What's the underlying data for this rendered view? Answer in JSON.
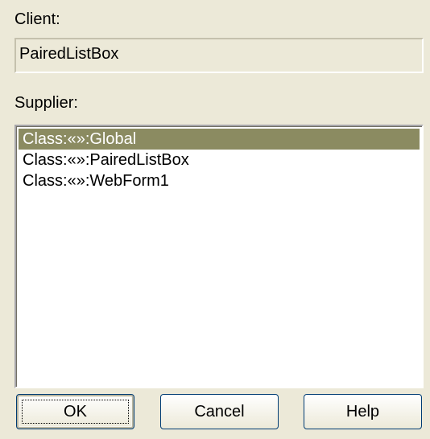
{
  "client": {
    "label": "Client:",
    "value": "PairedListBox"
  },
  "supplier": {
    "label": "Supplier:",
    "items": [
      {
        "text": "Class:«»:Global",
        "selected": true
      },
      {
        "text": "Class:«»:PairedListBox",
        "selected": false
      },
      {
        "text": "Class:«»:WebForm1",
        "selected": false
      }
    ]
  },
  "buttons": {
    "ok": "OK",
    "cancel": "Cancel",
    "help": "Help"
  },
  "colors": {
    "dialog_background": "#ece9d8",
    "selection_background": "#8b8b61",
    "selection_text": "#ffffff"
  }
}
